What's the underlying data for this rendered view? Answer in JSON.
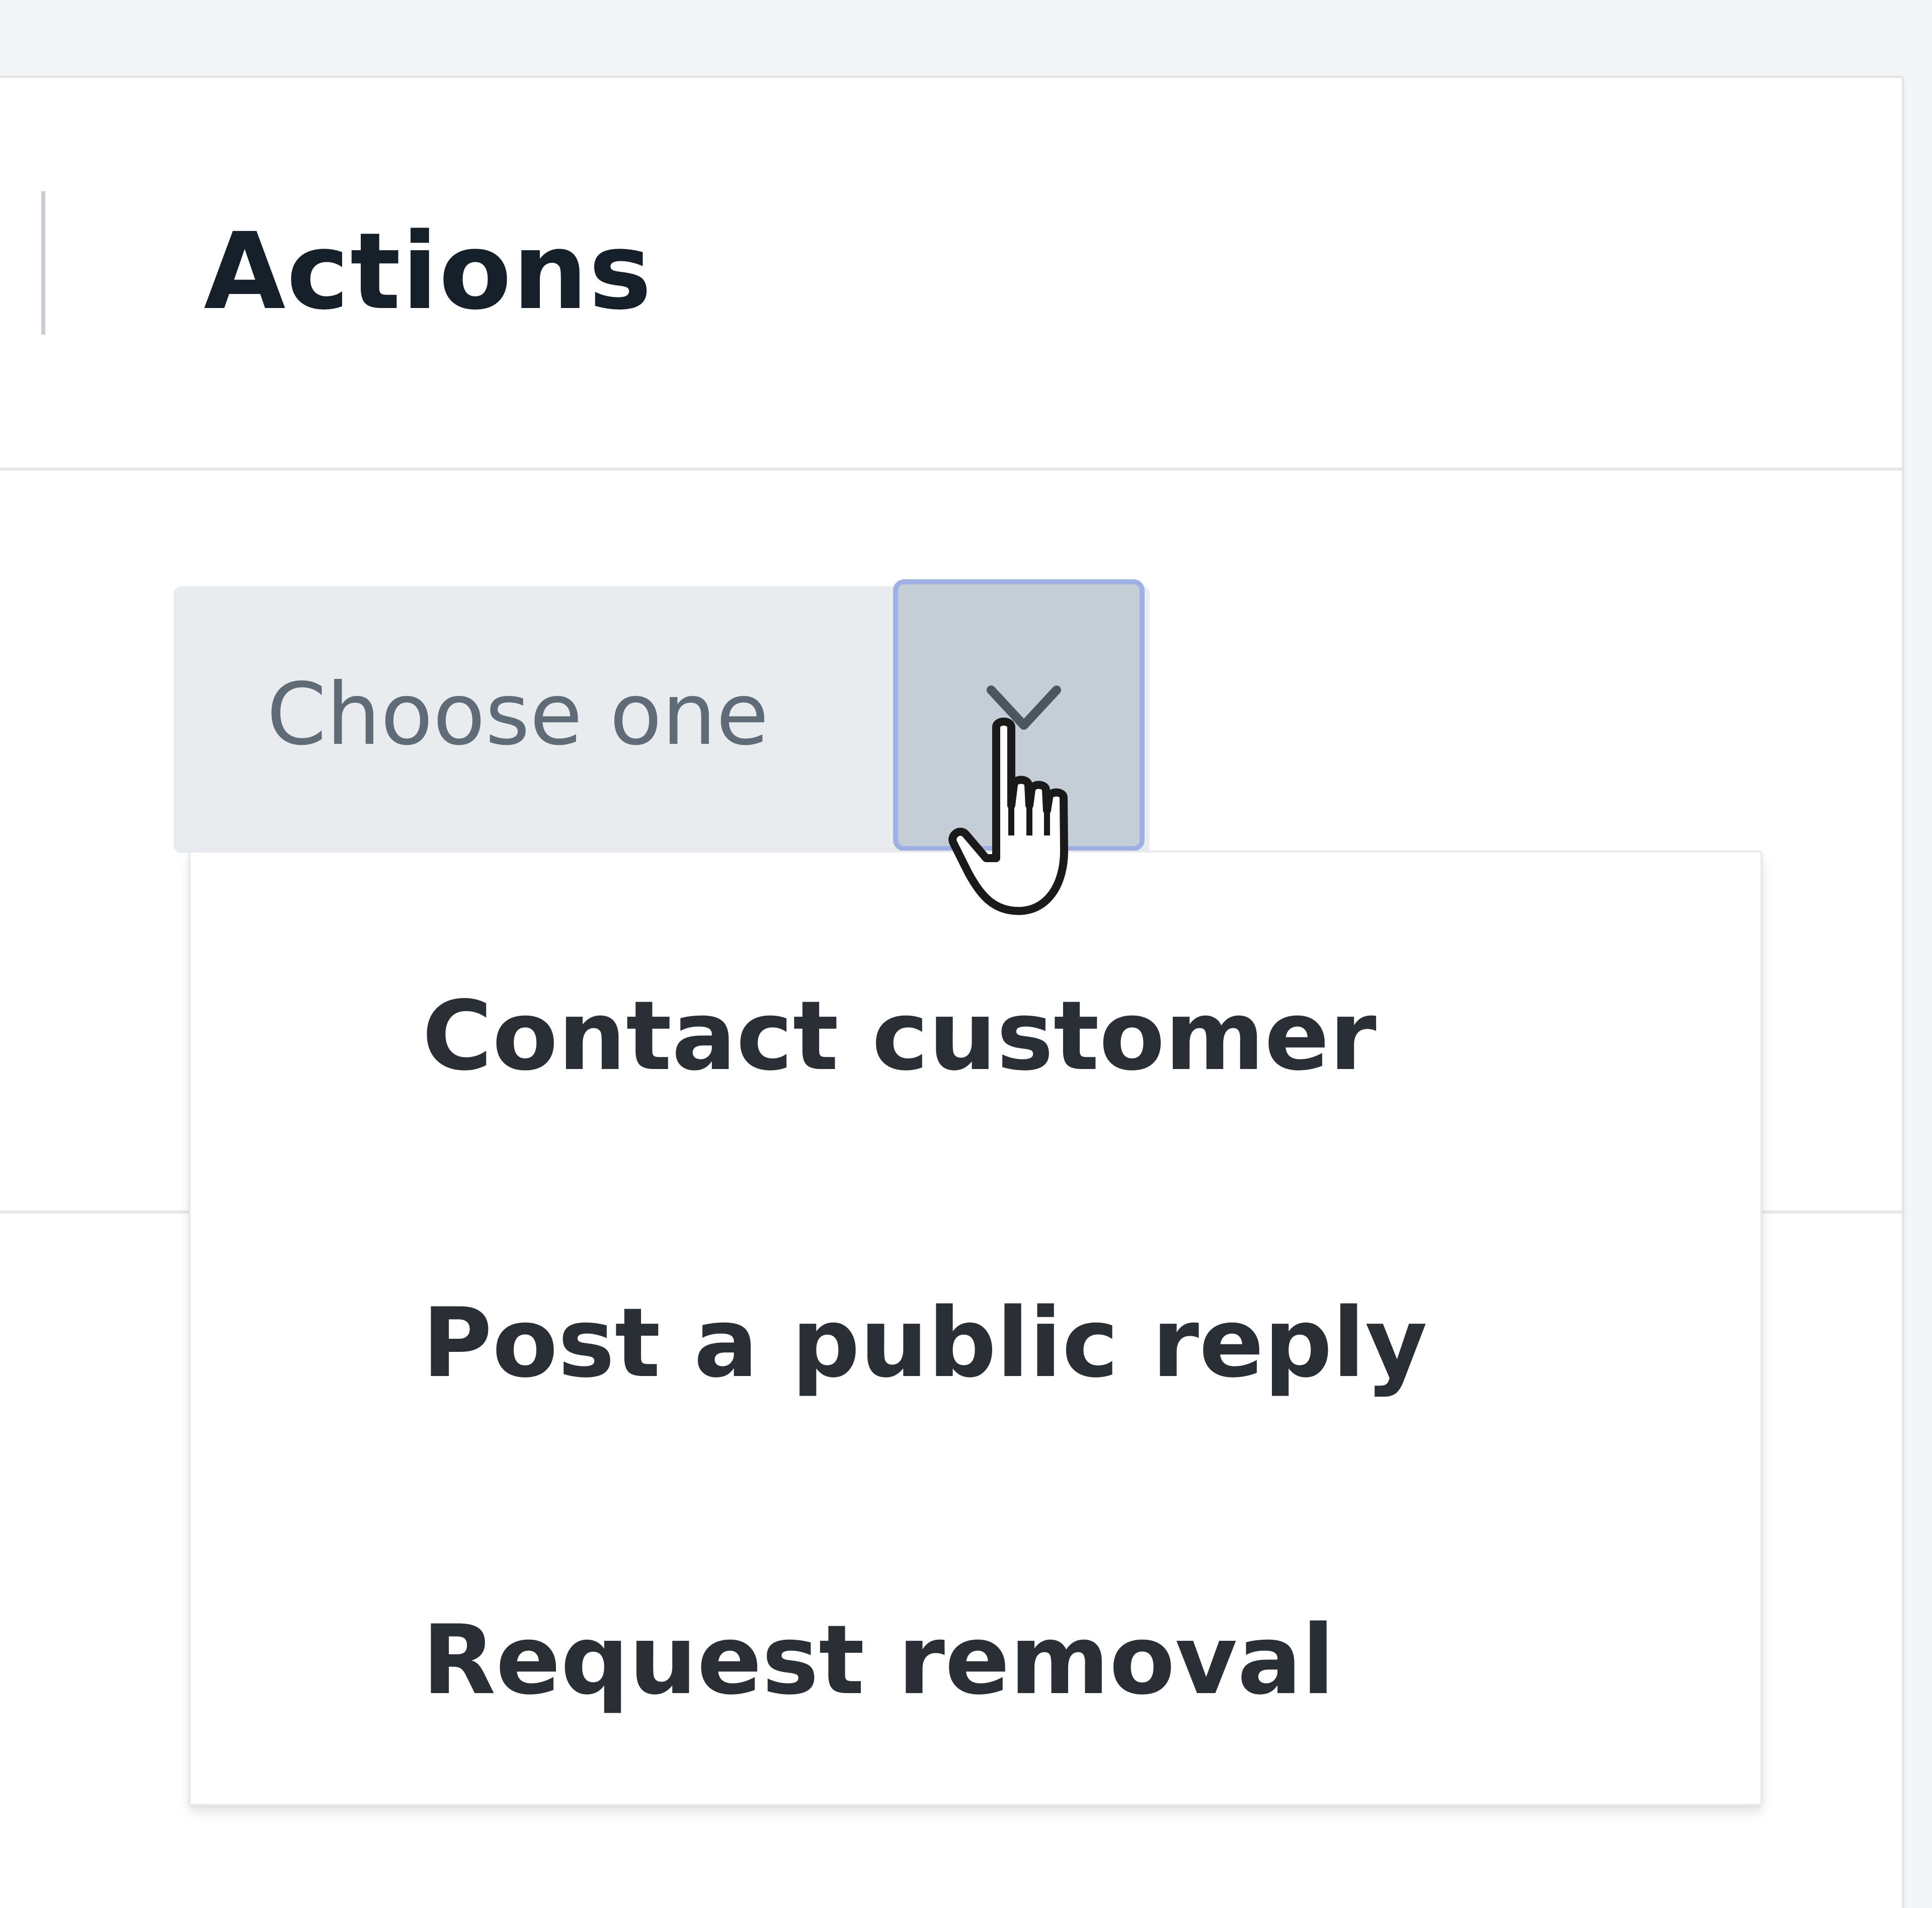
{
  "header": {
    "title": "Actions"
  },
  "action_select": {
    "value": "Choose one",
    "expanded": true,
    "toggle_icon": "chevron-down-icon",
    "options": [
      {
        "label": "Contact customer"
      },
      {
        "label": "Post a public reply"
      },
      {
        "label": "Request removal"
      }
    ]
  },
  "pointer": {
    "icon": "hand-pointer-icon"
  },
  "colors": {
    "select_background": "#e9ecef",
    "toggle_background": "#c5ced6",
    "toggle_focus_ring": "#9eb0e4",
    "title_text": "#16202a",
    "option_text": "#2a2f36"
  }
}
